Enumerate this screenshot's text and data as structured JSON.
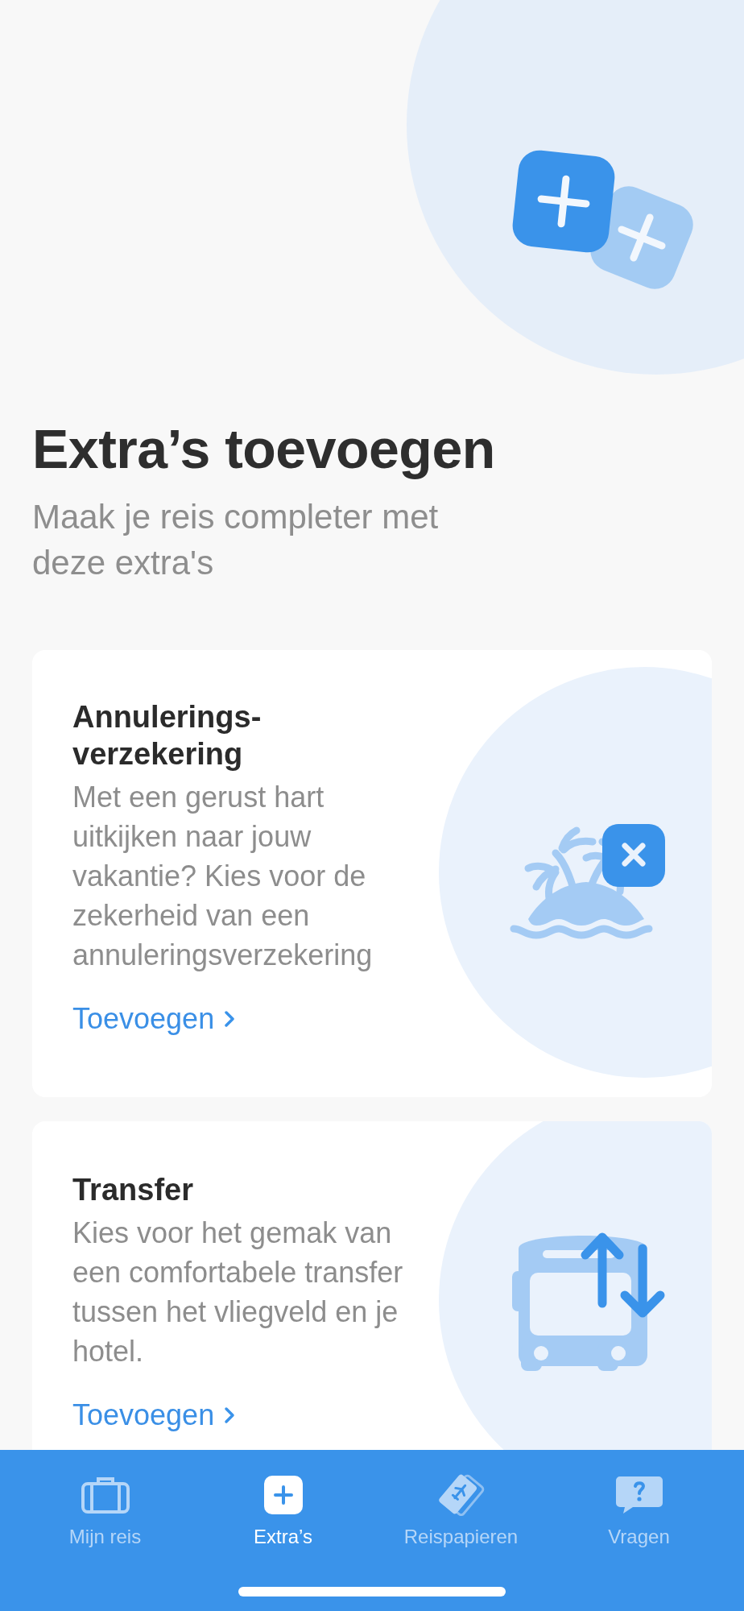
{
  "header": {
    "title": "Extra’s toevoegen",
    "subtitle": "Maak je reis completer met deze extra's"
  },
  "cards": [
    {
      "kind": "insurance",
      "title": "Annulerings-verzekering",
      "body": "Met een gerust hart uitkijken naar jouw vakantie? Kies voor de zekerheid van een annuleringsverzekering",
      "link": "Toevoegen"
    },
    {
      "kind": "transfer",
      "title": "Transfer",
      "body": "Kies voor het gemak van een comfortabele transfer tussen het vliegveld en je hotel.",
      "link": "Toevoegen"
    }
  ],
  "tab_bar": [
    {
      "kind": "suitcase",
      "label": "Mijn reis",
      "selected": false
    },
    {
      "kind": "plus",
      "label": "Extra’s",
      "selected": true
    },
    {
      "kind": "tickets",
      "label": "Reispapieren",
      "selected": false
    },
    {
      "kind": "question",
      "label": "Vragen",
      "selected": false
    }
  ]
}
